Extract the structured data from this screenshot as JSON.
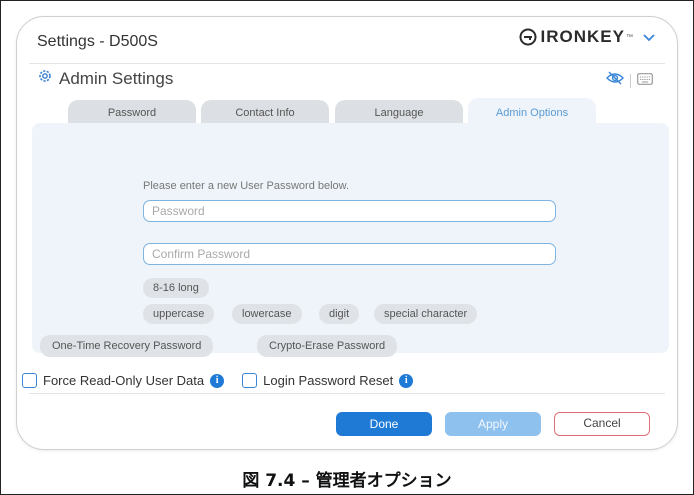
{
  "window": {
    "title": "Settings - D500S",
    "brand": "IRONKEY",
    "brand_tm": "™"
  },
  "header": {
    "title": "Admin Settings"
  },
  "tabs": [
    {
      "label": "Password",
      "active": false
    },
    {
      "label": "Contact Info",
      "active": false
    },
    {
      "label": "Language",
      "active": false
    },
    {
      "label": "Admin Options",
      "active": true
    }
  ],
  "form": {
    "prompt": "Please enter a new User Password below.",
    "password_placeholder": "Password",
    "confirm_placeholder": "Confirm Password",
    "requirements": {
      "length": "8-16 long",
      "uppercase": "uppercase",
      "lowercase": "lowercase",
      "digit": "digit",
      "special": "special character"
    },
    "otr_button": "One-Time Recovery Password",
    "crypto_button": "Crypto-Erase Password"
  },
  "options": {
    "force_readonly": {
      "label": "Force Read-Only User Data",
      "checked": false
    },
    "login_reset": {
      "label": "Login Password Reset",
      "checked": false
    }
  },
  "actions": {
    "done": "Done",
    "apply": "Apply",
    "cancel": "Cancel"
  },
  "colors": {
    "accent": "#1f7ad6",
    "apply_disabled": "#8fc1ef",
    "cancel_border": "#e0707a",
    "panel_bg": "#eef4f9"
  },
  "caption": "図 7.4 – 管理者オプション"
}
